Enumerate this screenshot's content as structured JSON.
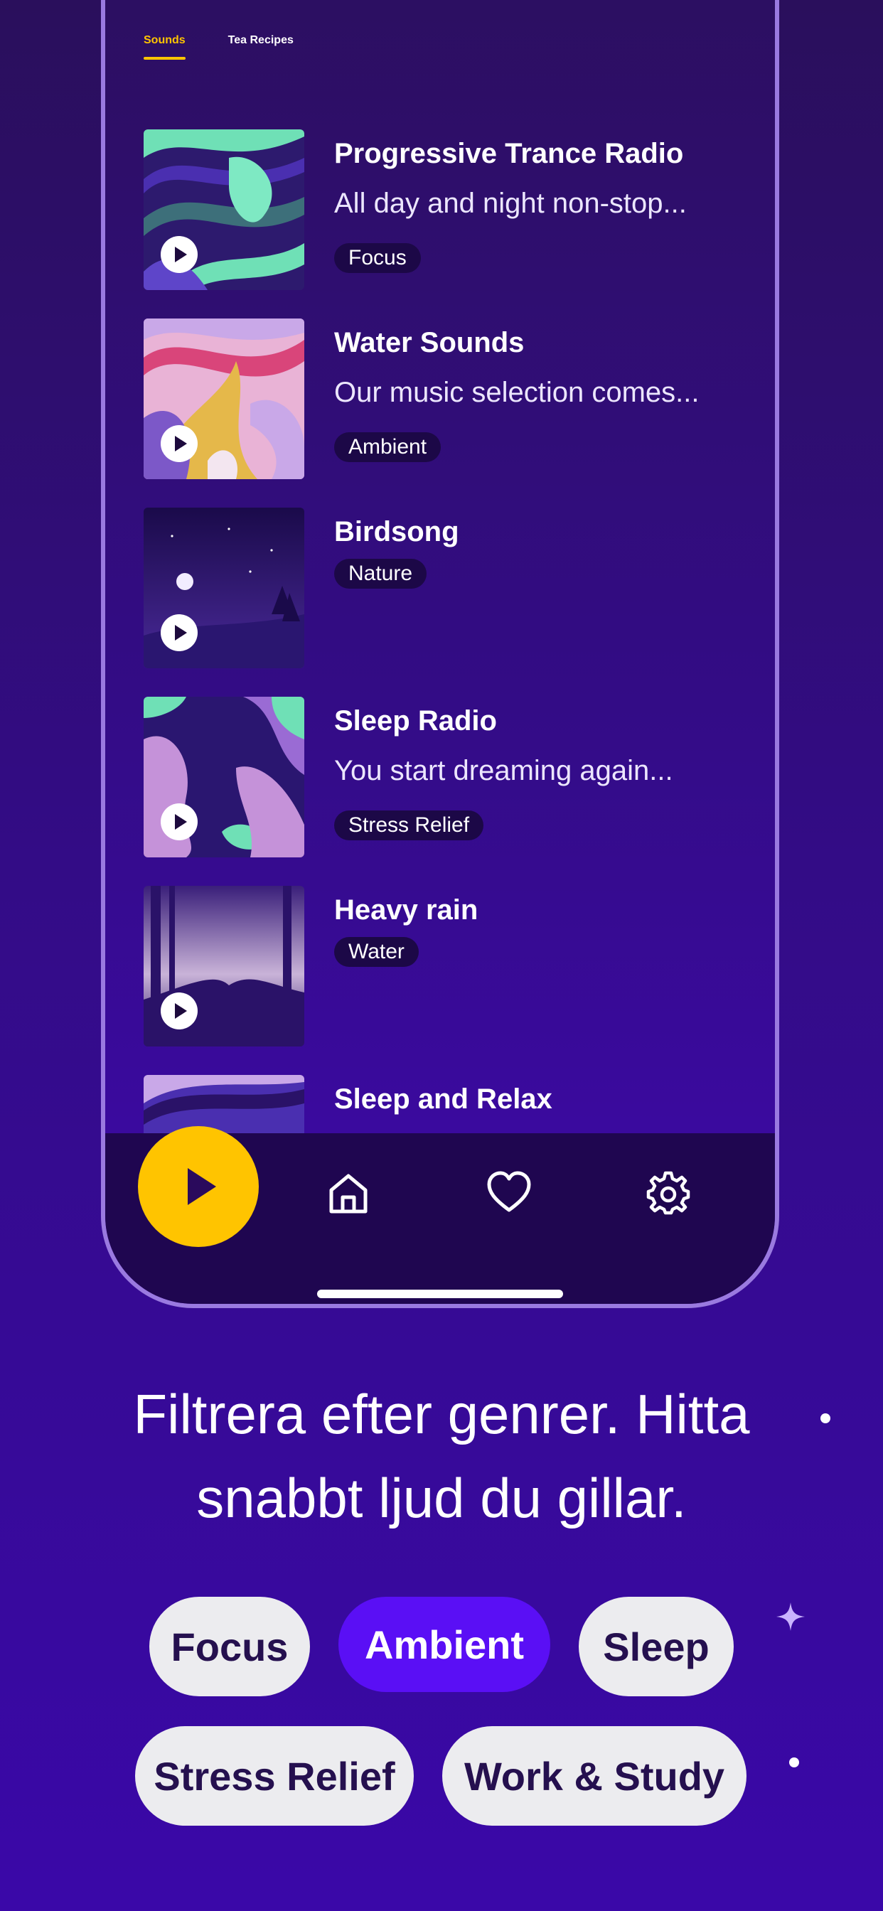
{
  "tabs": [
    {
      "label": "Sounds",
      "active": true
    },
    {
      "label": "Tea Recipes",
      "active": false
    }
  ],
  "sounds": [
    {
      "title": "Progressive Trance Radio",
      "description": "All day and night non-stop...",
      "tag": "Focus"
    },
    {
      "title": "Water Sounds",
      "description": "Our music selection comes...",
      "tag": "Ambient"
    },
    {
      "title": "Birdsong",
      "description": "",
      "tag": "Nature"
    },
    {
      "title": "Sleep Radio",
      "description": "You start dreaming again...",
      "tag": "Stress Relief"
    },
    {
      "title": "Heavy rain",
      "description": "",
      "tag": "Water"
    },
    {
      "title": "Sleep and Relax",
      "description": "",
      "tag": ""
    }
  ],
  "bottom_nav": {
    "play_icon": "play-icon",
    "home_icon": "home-icon",
    "favorites_icon": "heart-icon",
    "settings_icon": "gear-icon"
  },
  "headline": "Filtrera efter genrer. Hitta snabbt ljud du gillar.",
  "genre_chips": [
    {
      "label": "Focus",
      "selected": false
    },
    {
      "label": "Ambient",
      "selected": true
    },
    {
      "label": "Sleep",
      "selected": false
    },
    {
      "label": "Stress Relief",
      "selected": false
    },
    {
      "label": "Work & Study",
      "selected": false
    }
  ],
  "colors": {
    "accent": "#ffc400",
    "selected_chip": "#5a0ff5",
    "background": "#330c86"
  }
}
